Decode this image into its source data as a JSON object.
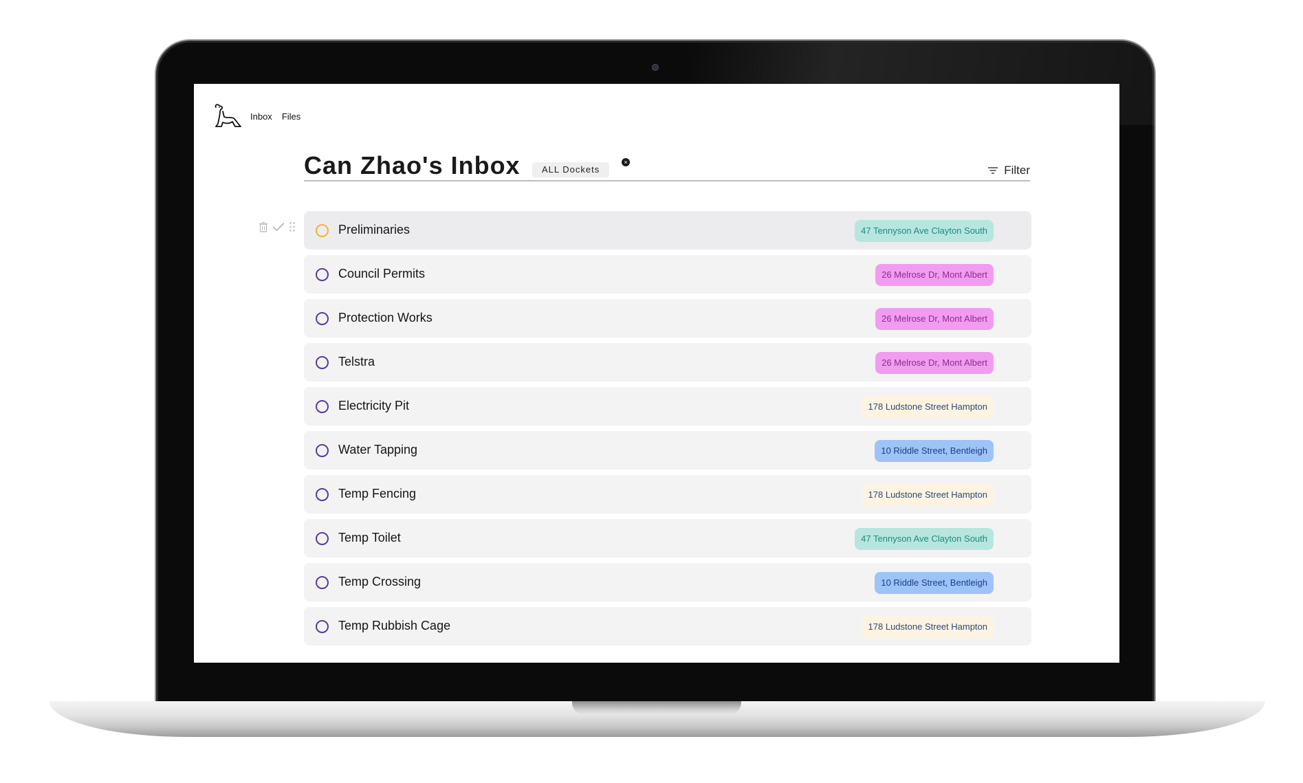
{
  "nav": {
    "inbox": "Inbox",
    "files": "Files"
  },
  "header": {
    "title": "Can Zhao's Inbox",
    "docket_filter": "ALL Dockets",
    "filter_label": "Filter"
  },
  "tag_styles": {
    "teal": {
      "bg": "#b7e6df",
      "fg": "#1f8a7e"
    },
    "pink": {
      "bg": "#f19cf0",
      "fg": "#8a2e8d"
    },
    "cream": {
      "bg": "#fdf3e1",
      "fg": "#2d4a7a"
    },
    "blue": {
      "bg": "#9ec3f6",
      "fg": "#1c3e86"
    }
  },
  "tasks": [
    {
      "label": "Preliminaries",
      "tag": "47 Tennyson Ave Clayton South",
      "style": "teal",
      "status": "active"
    },
    {
      "label": "Council Permits",
      "tag": "26 Melrose Dr, Mont Albert",
      "style": "pink",
      "status": "todo"
    },
    {
      "label": "Protection Works",
      "tag": "26 Melrose Dr, Mont Albert",
      "style": "pink",
      "status": "todo"
    },
    {
      "label": "Telstra",
      "tag": "26 Melrose Dr, Mont Albert",
      "style": "pink",
      "status": "todo"
    },
    {
      "label": "Electricity Pit",
      "tag": "178 Ludstone Street Hampton",
      "style": "cream",
      "status": "todo"
    },
    {
      "label": "Water Tapping",
      "tag": "10 Riddle Street, Bentleigh",
      "style": "blue",
      "status": "todo"
    },
    {
      "label": "Temp Fencing",
      "tag": "178 Ludstone Street Hampton",
      "style": "cream",
      "status": "todo"
    },
    {
      "label": "Temp Toilet",
      "tag": "47 Tennyson Ave Clayton South",
      "style": "teal",
      "status": "todo"
    },
    {
      "label": "Temp Crossing",
      "tag": "10 Riddle Street, Bentleigh",
      "style": "blue",
      "status": "todo"
    },
    {
      "label": "Temp Rubbish Cage",
      "tag": "178 Ludstone Street Hampton",
      "style": "cream",
      "status": "todo"
    }
  ],
  "icons": {
    "logo": "dog-logo-icon",
    "delete": "trash-icon",
    "complete": "checkmark-icon",
    "drag": "drag-handle-icon",
    "filter": "filter-icon",
    "clear": "close-icon"
  }
}
